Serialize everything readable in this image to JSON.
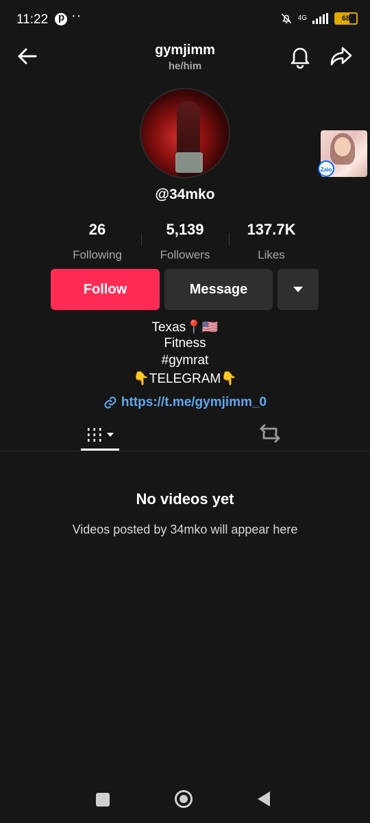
{
  "status_bar": {
    "time": "11:22",
    "network": "4G",
    "battery": "68",
    "battery_level": 0.68,
    "accent_color": "#e0a800"
  },
  "header": {
    "username": "gymjimm",
    "pronouns": "he/him",
    "icons": [
      "back-arrow-icon",
      "bell-icon",
      "share-icon"
    ]
  },
  "profile": {
    "handle": "@34mko"
  },
  "stats": [
    {
      "value": "26",
      "label": "Following"
    },
    {
      "value": "5,139",
      "label": "Followers"
    },
    {
      "value": "137.7K",
      "label": "Likes"
    }
  ],
  "actions": {
    "follow_label": "Follow",
    "message_label": "Message",
    "follow_color": "#fe2c55"
  },
  "bio": {
    "lines": [
      "Texas📍🇺🇸",
      "Fitness",
      "#gymrat",
      "👇TELEGRAM👇"
    ],
    "link": "https://t.me/gymjimm_0",
    "link_color": "#5fa8f0"
  },
  "floating_bubble": {
    "badge": "Zalo"
  },
  "empty_state": {
    "title": "No videos yet",
    "subtitle": "Videos posted by 34mko will appear here"
  }
}
